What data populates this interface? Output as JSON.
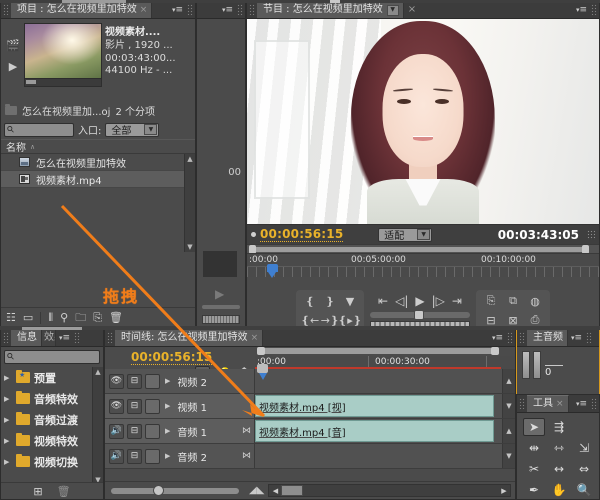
{
  "app": {
    "name": "Adobe Premiere Pro"
  },
  "project_panel": {
    "tab_label": "项目 : 怎么在视频里加特效",
    "close_glyph": "×",
    "menu_glyph": "≡",
    "preview": {
      "clip_name": "视频素材....",
      "line2": "影片 , 1920 ...",
      "line3": "00:03:43:00...",
      "line4": "44100 Hz - ...",
      "poster_icon": "filmstrip-icon",
      "play_icon": "▶"
    },
    "bin_row": {
      "name": "怎么在视频里加...oj",
      "count": "2 个分项"
    },
    "search_placeholder": "",
    "filter_label": "入口:",
    "filter_value": "全部",
    "column_header": "名称",
    "sort_glyph": "∧",
    "items": [
      {
        "label": "怎么在视频里加特效",
        "icon": "sequence-icon",
        "selected": false
      },
      {
        "label": "视频素材.mp4",
        "icon": "clip-icon",
        "selected": true
      }
    ],
    "footer_icons": [
      "list-view-icon",
      "icon-view-icon",
      "divider",
      "freeform-icon",
      "find-icon",
      "new-bin-icon",
      "new-item-icon",
      "clear-icon"
    ]
  },
  "source_panel": {
    "menu_glyph": "≡",
    "timecode_partial": "00"
  },
  "program_panel": {
    "tab_label": "节目 : 怎么在视频里加特效",
    "tab_caret": "▼",
    "close_glyph": "×",
    "menu_glyph": "≡",
    "playhead_timecode": "00:00:56:15",
    "duration_timecode": "00:03:43:05",
    "zoom_level": "适配",
    "zoom_caret": "▼",
    "ruler_labels": [
      ":00:00",
      "00:05:00:00",
      "00:10:00:00"
    ],
    "controls": {
      "left_group": [
        "mark-in-icon",
        "mark-out-icon",
        "add-marker-icon",
        "goto-in-icon",
        "goto-out-icon",
        "play-in-to-out-icon"
      ],
      "transport": [
        "step-back-to-in-icon",
        "step-back-icon",
        "play-icon",
        "step-forward-icon",
        "step-forward-to-out-icon"
      ],
      "right_group": [
        "export-frame-icon",
        "safe-margins-icon",
        "output-quality-icon",
        "lift-icon",
        "extract-icon",
        "trim-icon"
      ]
    }
  },
  "effects_panel": {
    "tab_label": "信息",
    "tab_secondary": "效果",
    "menu_glyph": "≡",
    "search_placeholder": "",
    "folders": [
      {
        "label": "预置",
        "icon": "preset-folder-icon"
      },
      {
        "label": "音频特效",
        "icon": "folder-icon"
      },
      {
        "label": "音频过渡",
        "icon": "folder-icon"
      },
      {
        "label": "视频特效",
        "icon": "folder-icon"
      },
      {
        "label": "视频切换",
        "icon": "folder-icon"
      }
    ],
    "footer_icons": [
      "new-custom-bin-icon",
      "delete-icon"
    ]
  },
  "timeline_panel": {
    "tab_label": "时间线: 怎么在视频里加特效",
    "close_glyph": "×",
    "menu_glyph": "≡",
    "playhead_timecode": "00:00:56:15",
    "snap_icon": "snap-icon",
    "bulb_icon": "bulb-icon",
    "marker_icon": "marker-icon",
    "ruler_labels": [
      ":00:00",
      "00:00:30:00"
    ],
    "tracks": [
      {
        "name": "视频 2",
        "type": "video",
        "clip": null,
        "selected": false
      },
      {
        "name": "视频 1",
        "type": "video",
        "clip": "视频素材.mp4 [视]",
        "selected": true
      },
      {
        "name": "音频 1",
        "type": "audio",
        "clip": "视频素材.mp4 [音]",
        "selected": true
      },
      {
        "name": "音频 2",
        "type": "audio",
        "clip": null,
        "selected": false
      }
    ],
    "track_icons": {
      "eye": "👁",
      "audio": "🔊",
      "sync": "sync-lock-icon",
      "expand": "▶",
      "lock": "lock-icon"
    },
    "clip_color": "#a9cdc6"
  },
  "audio_master_panel": {
    "tab_label": "主音频",
    "menu_glyph": "≡",
    "level_label": "0"
  },
  "tools_panel": {
    "tab_label": "工具",
    "close_glyph": "×",
    "menu_glyph": "≡",
    "tools": [
      {
        "name": "selection-tool",
        "glyph": "➤",
        "active": true
      },
      {
        "name": "track-select-tool",
        "glyph": "⇶",
        "active": false
      },
      {
        "name": "ripple-edit-tool",
        "glyph": "⇹",
        "active": false
      },
      {
        "name": "rolling-edit-tool",
        "glyph": "⇿",
        "active": false
      },
      {
        "name": "rate-stretch-tool",
        "glyph": "⇲",
        "active": false
      },
      {
        "name": "razor-tool",
        "glyph": "✂",
        "active": false
      },
      {
        "name": "slip-tool",
        "glyph": "↔",
        "active": false
      },
      {
        "name": "slide-tool",
        "glyph": "⇔",
        "active": false
      },
      {
        "name": "pen-tool",
        "glyph": "✒",
        "active": false
      },
      {
        "name": "hand-tool",
        "glyph": "✋",
        "active": false
      },
      {
        "name": "zoom-tool",
        "glyph": "🔍",
        "active": false
      }
    ]
  },
  "annotation": {
    "label": "拖拽",
    "color": "#f07d1a"
  }
}
